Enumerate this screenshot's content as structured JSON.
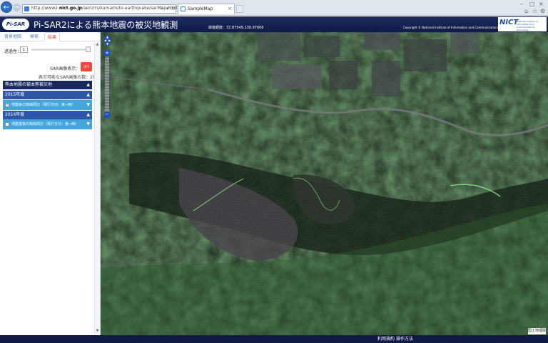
{
  "browser": {
    "url_prefix": "http://www2.",
    "url_domain": "nict.go.jp",
    "url_path": "/aeri/rrs/kumamoto-earthquake/sarMap.html",
    "tab_title": "SampleMap"
  },
  "header": {
    "logo_text": "Pi-SAR",
    "title": "Pi-SAR2による熊本地震の被災地観測",
    "coordinates": "緯度経度：32.87549,130.97609",
    "copyright": "Copyright © National Institute of Information and Communications Technology. All Rights Reserved.",
    "org_logo": "NICT"
  },
  "sidebar": {
    "tabs": [
      {
        "label": "背景地図",
        "active": false
      },
      {
        "label": "検索",
        "active": false
      },
      {
        "label": "結果",
        "active": true
      }
    ],
    "transparency_label": "透過性：",
    "transparency_value": "1",
    "sar_display_label": "SAR画像表示：",
    "sar_toggle": "OFF",
    "available_count_text": "表示可能なSAR画像の数：2件",
    "main_section": "熊本地震の被本熊被災地",
    "groups": [
      {
        "year": "2015年度",
        "item": "地震後の熊曲周辺（飛行方向：東→西）",
        "checked": true
      },
      {
        "year": "2016年度",
        "item": "地震直後の熊曲周辺（飛行方向：東→西）",
        "checked": false
      }
    ]
  },
  "map": {
    "attribution": "国土地理院"
  },
  "footer": {
    "terms": "利用規約",
    "howto": "操作方法"
  },
  "colors": {
    "header_bg": "#1e2c63",
    "section_dark": "#17285c",
    "section_year": "#2f55a8",
    "item_row": "#43a6dc",
    "toggle_off": "#e74c3c",
    "active_tab": "#e8463d"
  }
}
